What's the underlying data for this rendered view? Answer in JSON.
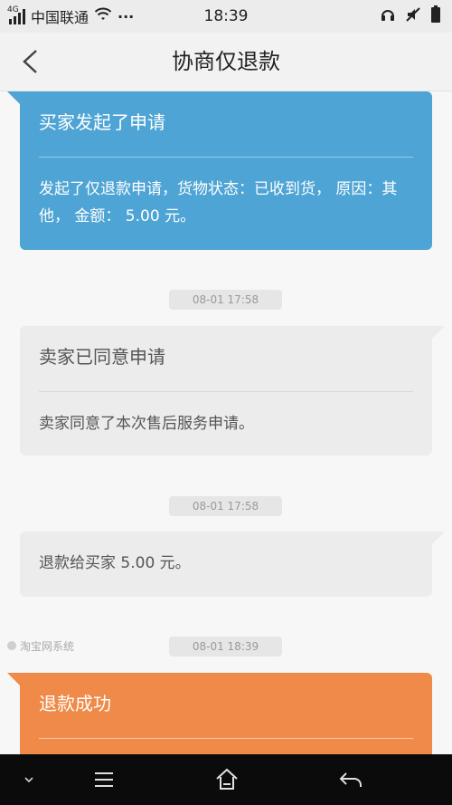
{
  "status_bar": {
    "network_type": "4G",
    "carrier": "中国联通",
    "more": "···",
    "time": "18:39",
    "icons": [
      "signal-icon",
      "wifi-icon",
      "headset-icon",
      "mute-icon",
      "battery-icon"
    ]
  },
  "nav": {
    "title": "协商仅退款",
    "back_icon": "chevron-left-icon"
  },
  "messages": {
    "buyer_request": {
      "title": "买家发起了申请",
      "body": "发起了仅退款申请，货物状态：已收到货， 原因：其他， 金额： 5.00 元。"
    },
    "time_1": "08-01 17:58",
    "seller_agree": {
      "title": "卖家已同意申请",
      "body": "卖家同意了本次售后服务申请。"
    },
    "time_2": "08-01 17:58",
    "refund_note": {
      "body": "退款给买家 5.00 元。"
    },
    "sender": "淘宝网系统",
    "time_3": "08-01 18:39",
    "refund_success": {
      "title": "退款成功"
    }
  },
  "bottom_nav": {
    "icons": [
      "chevron-down-icon",
      "menu-icon",
      "home-icon",
      "back-arrow-icon"
    ]
  },
  "colors": {
    "blue_card": "#4ea4d4",
    "gray_card": "#ececec",
    "orange_card": "#f08a48",
    "bottom_bar": "#0b0b0b"
  }
}
